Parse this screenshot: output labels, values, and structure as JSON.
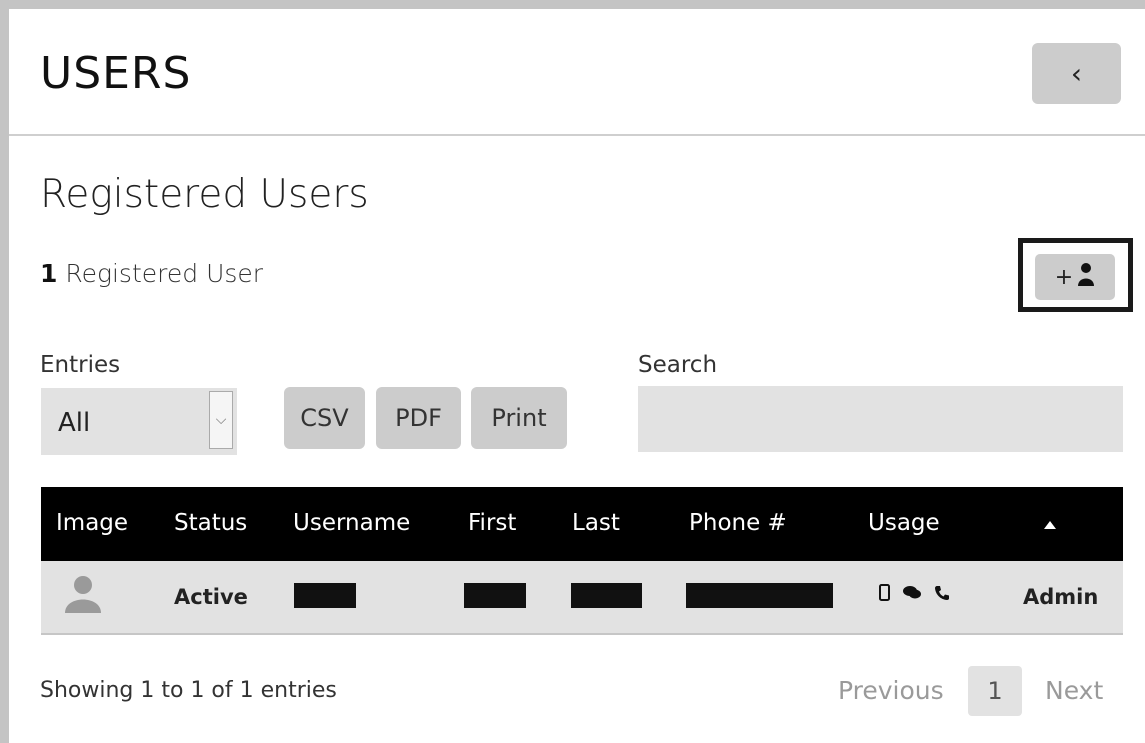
{
  "header": {
    "title": "USERS",
    "back_glyph": "‹",
    "back_icon": "chevron-left-icon"
  },
  "section": {
    "title": "Registered Users",
    "count": "1",
    "count_label": "Registered User"
  },
  "add_user": {
    "plus": "+",
    "icon": "user-icon"
  },
  "controls": {
    "entries_label": "Entries",
    "entries_value": "All",
    "export_buttons": [
      "CSV",
      "PDF",
      "Print"
    ],
    "search_label": "Search",
    "search_value": ""
  },
  "table": {
    "columns": [
      "Image",
      "Status",
      "Username",
      "First",
      "Last",
      "Phone #",
      "Usage",
      ""
    ],
    "rows": [
      {
        "image": "avatar-icon",
        "status": "Active",
        "username": "[redacted]",
        "first": "[redacted]",
        "last": "[redacted]",
        "phone": "[redacted]",
        "usage": [
          "mobile-icon",
          "chat-icon",
          "phone-icon"
        ],
        "role": "Admin"
      }
    ]
  },
  "footer": {
    "showing": "Showing 1 to 1 of 1 entries",
    "previous": "Previous",
    "current_page": "1",
    "next": "Next"
  },
  "colors": {
    "button_bg": "#cccccc",
    "header_bg": "#000000",
    "row_bg": "#e2e2e2",
    "highlight_border": "#1a1a1a"
  }
}
